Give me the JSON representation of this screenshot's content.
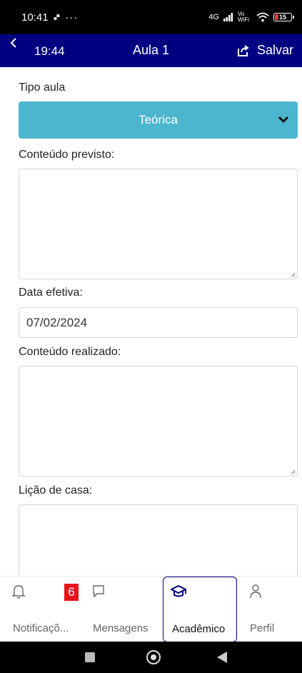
{
  "status_bar": {
    "time": "10:41",
    "extra": "🙾",
    "dots": "···",
    "network": "4G",
    "wifi_label": "Vo WiFi",
    "battery": "15",
    "battery_color": "#e53935"
  },
  "app_bar": {
    "back_icon": "chevron-left-icon",
    "clock": "19:44",
    "title": "Aula 1",
    "save_label": "Salvar",
    "background": "#000080"
  },
  "form": {
    "tipo_aula_label": "Tipo aula",
    "tipo_aula_value": "Teórica",
    "select_color": "#4db6cf",
    "conteudo_previsto_label": "Conteúdo previsto:",
    "data_efetiva_label": "Data efetiva:",
    "data_efetiva_value": "07/02/2024",
    "conteudo_realizado_label": "Conteúdo realizado:",
    "licao_casa_label": "Lição de casa:"
  },
  "bottom_nav": {
    "items": [
      {
        "label": "Notificaçõ...",
        "icon": "bell-icon",
        "badge": "6"
      },
      {
        "label": "Mensagens",
        "icon": "chat-icon"
      },
      {
        "label": "Acadêmico",
        "icon": "graduation-cap-icon",
        "active": true
      },
      {
        "label": "Perfil",
        "icon": "user-icon"
      }
    ]
  }
}
